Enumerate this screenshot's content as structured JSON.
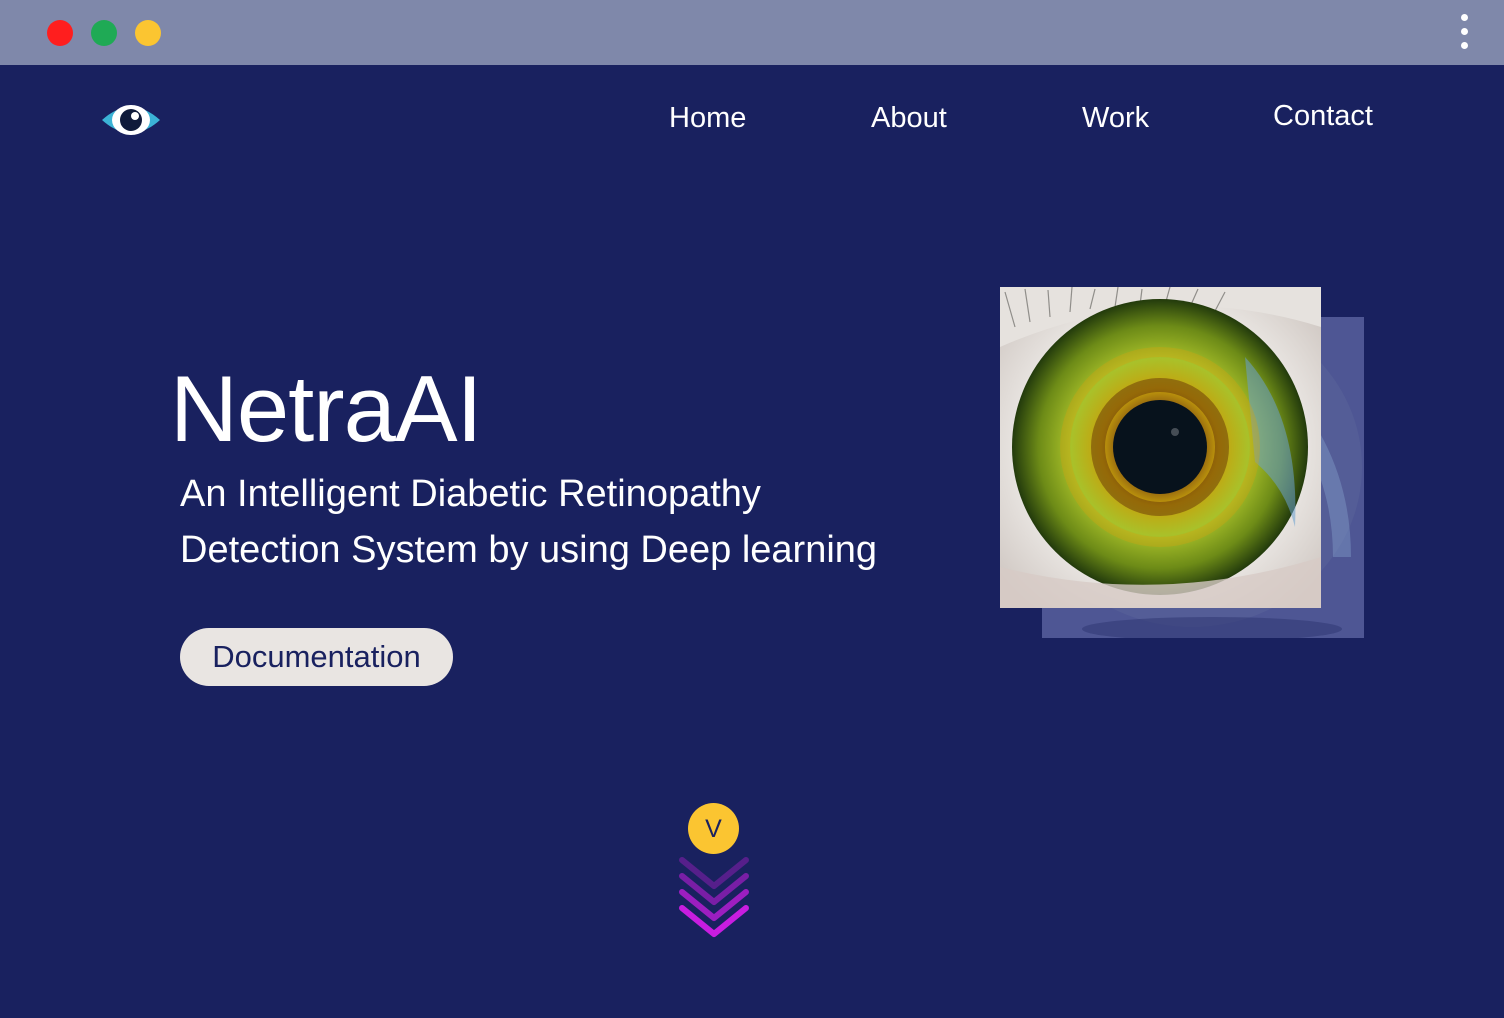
{
  "window": {
    "controls": [
      {
        "name": "close",
        "color": "#ff1e1e"
      },
      {
        "name": "maximize",
        "color": "#1faa55"
      },
      {
        "name": "minimize",
        "color": "#fbc531"
      }
    ],
    "menu_icon": "more-vertical-icon"
  },
  "nav": {
    "logo_icon": "eye-icon",
    "links": [
      "Home",
      "About",
      "Work",
      "Contact"
    ]
  },
  "hero": {
    "title": "NetraAI",
    "subtitle_line1": "An Intelligent Diabetic Retinopathy",
    "subtitle_line2": "Detection System by using Deep learning",
    "button_label": "Documentation",
    "image_icon": "eye-iris-image"
  },
  "scroll": {
    "badge_label": "V",
    "chevron_icon": "chevrons-down-icon"
  },
  "colors": {
    "background": "#19215f",
    "titlebar": "#7f88aa",
    "button_bg": "#e9e5e2",
    "badge": "#fbc531",
    "chevron": "#c81de0"
  }
}
